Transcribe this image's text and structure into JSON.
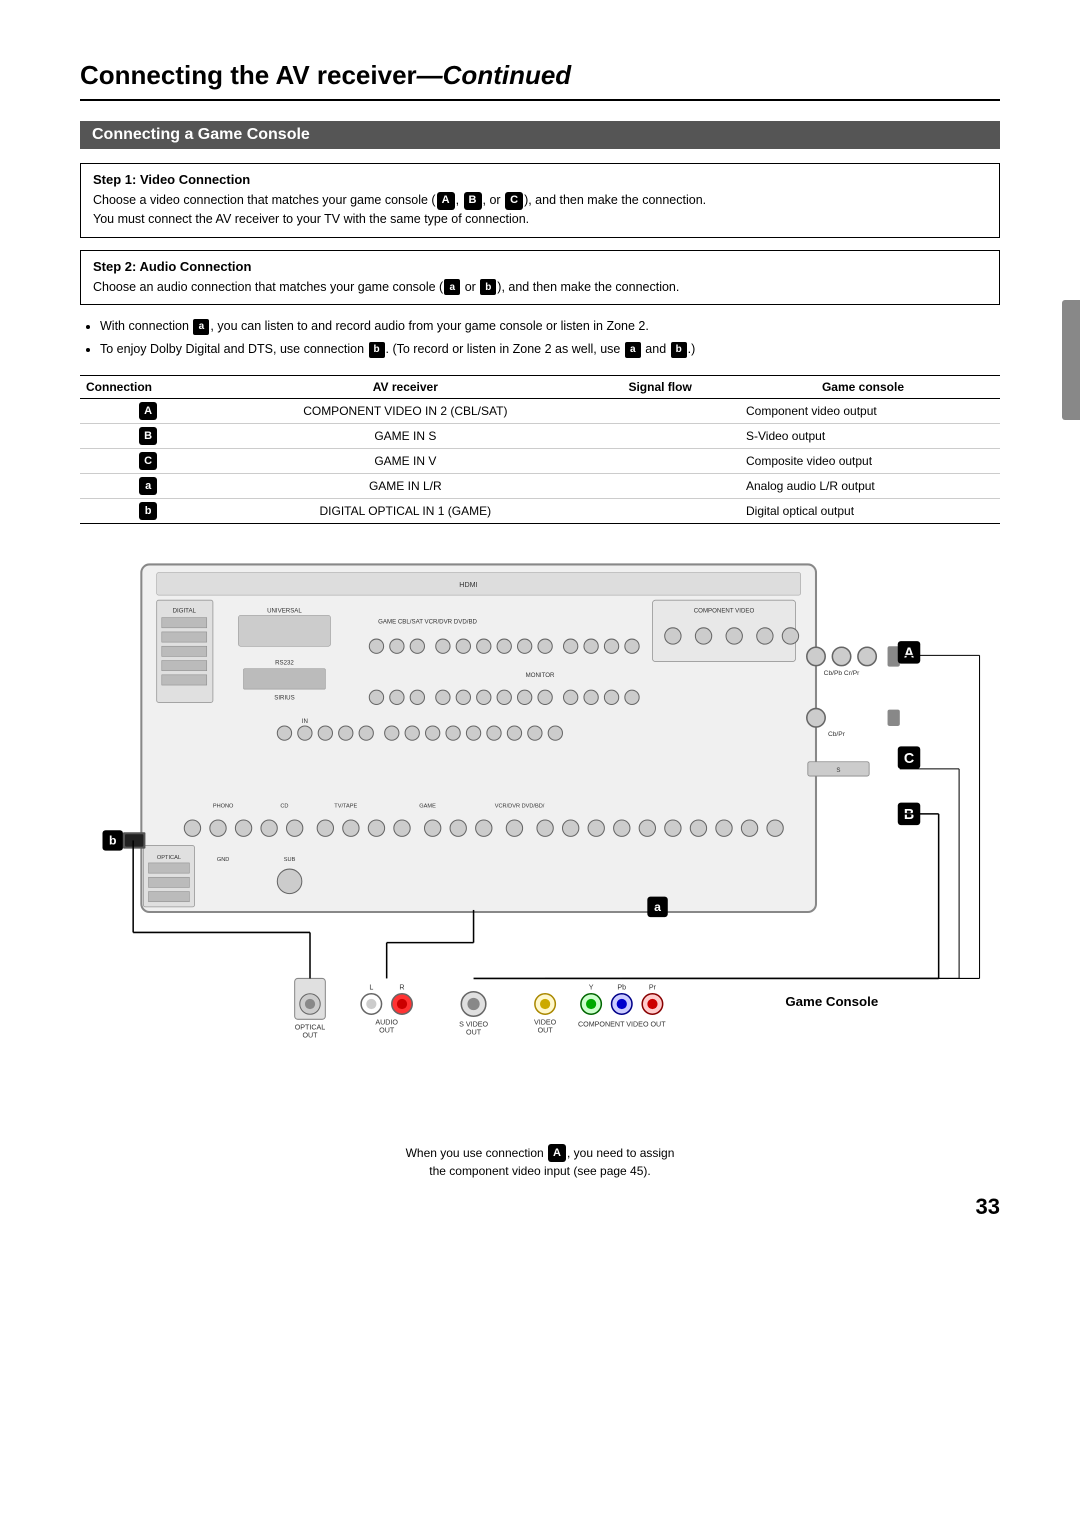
{
  "page": {
    "number": "33",
    "title": "Connecting the AV receiver",
    "title_continued": "—Continued"
  },
  "section": {
    "heading": "Connecting a Game Console"
  },
  "step1": {
    "title": "Step 1: Video Connection",
    "text1": "Choose a video connection that matches your game console (",
    "badge1": "A",
    "sep1": ", ",
    "badge2": "B",
    "sep2": ", or ",
    "badge3": "C",
    "text2": "), and then make the connection.",
    "text3": "You must connect the AV receiver to your TV with the same type of connection."
  },
  "step2": {
    "title": "Step 2: Audio Connection",
    "text1": "Choose an audio connection that matches your game console (",
    "badge1": "a",
    "sep1": " or ",
    "badge2": "b",
    "text2": "), and then make the connection."
  },
  "bullets": [
    "With connection a, you can listen to and record audio from your game console or listen in Zone 2.",
    "To enjoy Dolby Digital and DTS, use connection b. (To record or listen in Zone 2 as well, use a and b.)"
  ],
  "table": {
    "headers": [
      "Connection",
      "AV receiver",
      "Signal flow",
      "Game console"
    ],
    "rows": [
      {
        "badge": "A",
        "av": "COMPONENT VIDEO IN 2 (CBL/SAT)",
        "signal": "",
        "console": "Component video output"
      },
      {
        "badge": "B",
        "av": "GAME IN S",
        "signal": "",
        "console": "S-Video output"
      },
      {
        "badge": "C",
        "av": "GAME IN V",
        "signal": "",
        "console": "Composite video output"
      },
      {
        "badge": "a",
        "av": "GAME IN L/R",
        "signal": "",
        "console": "Analog audio L/R output"
      },
      {
        "badge": "b",
        "av": "DIGITAL OPTICAL IN 1 (GAME)",
        "signal": "",
        "console": "Digital optical output"
      }
    ]
  },
  "diagram": {
    "label_A": "A",
    "label_B": "B",
    "label_C": "C",
    "label_a": "a",
    "label_b": "b",
    "game_console_label": "Game Console",
    "caption_line1": "When you use connection A, you need to assign",
    "caption_line2": "the component video input (see page 45)."
  },
  "labels": {
    "optical_out": "OPTICAL OUT",
    "audio_out": "AUDIO OUT",
    "s_video_out": "S VIDEO OUT",
    "video_out": "VIDEO OUT",
    "component_video_out": "COMPONENT VIDEO OUT",
    "L": "L",
    "R": "R",
    "Y": "Y",
    "Pb": "Pb",
    "Pr": "Pr"
  }
}
